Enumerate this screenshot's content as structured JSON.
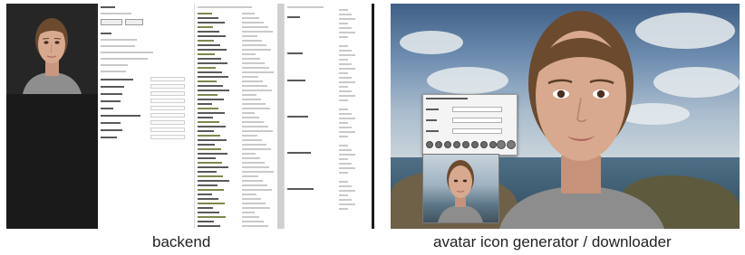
{
  "captions": {
    "backend": "backend",
    "generator": "avatar icon generator / downloader"
  },
  "backend": {
    "button_labels": [
      "",
      ""
    ],
    "note": ""
  },
  "generator": {
    "dialog_icons": [
      "circle-icon",
      "circle-icon",
      "circle-icon",
      "circle-icon",
      "circle-icon",
      "circle-icon",
      "circle-icon",
      "circle-icon"
    ]
  },
  "colors": {
    "backend_bg": "#1a1a1a",
    "sky_top": "#3f5f86",
    "skin": "#d8a98e",
    "hair": "#6b4a2e",
    "shirt": "#8d8d8d"
  }
}
